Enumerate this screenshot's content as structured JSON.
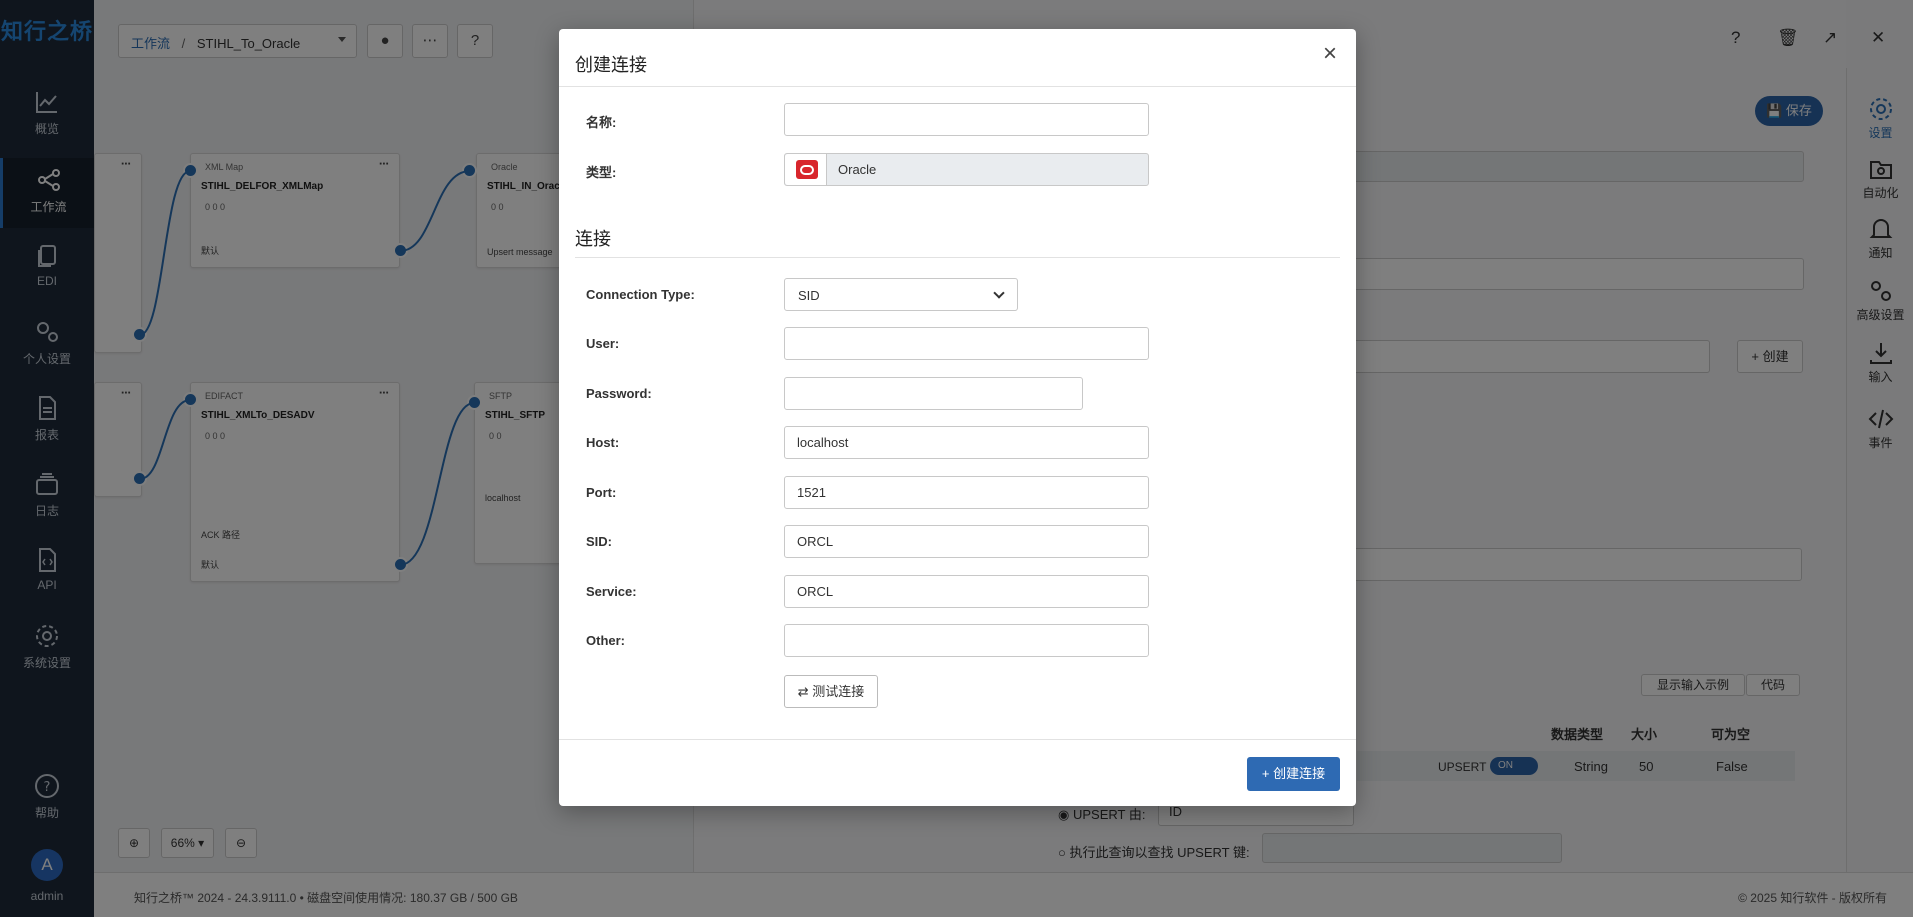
{
  "app": {
    "logo": "知行之桥",
    "nav": [
      {
        "label": "概览",
        "icon": "chart-line-icon"
      },
      {
        "label": "工作流",
        "icon": "workflow-icon"
      },
      {
        "label": "EDI",
        "icon": "documents-icon"
      },
      {
        "label": "个人设置",
        "icon": "user-settings-icon"
      },
      {
        "label": "报表",
        "icon": "report-icon"
      },
      {
        "label": "日志",
        "icon": "log-icon"
      },
      {
        "label": "API",
        "icon": "api-icon"
      },
      {
        "label": "系统设置",
        "icon": "gear-icon"
      },
      {
        "label": "帮助",
        "icon": "help-icon"
      }
    ],
    "user": {
      "initial": "A",
      "name": "admin"
    }
  },
  "workflow": {
    "breadcrumb_link": "工作流",
    "breadcrumb_sep": "/",
    "flow_name": "STIHL_To_Oracle",
    "zoom": "66%",
    "nodes": [
      {
        "tag": "XML Map",
        "name": "STIHL_DELFOR_XMLMap",
        "stats": "0   0   0",
        "foot": "默认"
      },
      {
        "tag": "Oracle",
        "name": "STIHL_IN_Oracle",
        "stats": "0   0",
        "foot": "Upsert message"
      },
      {
        "tag": "EDIFACT",
        "name": "STIHL_XMLTo_DESADV",
        "stats": "0   0   0",
        "foot": "默认",
        "mid": "ACK 路径"
      },
      {
        "tag": "SFTP",
        "name": "STIHL_SFTP",
        "stats": "0   0",
        "foot": "localhost"
      }
    ]
  },
  "right_panel": {
    "save_label": "保存",
    "create_label": "创建",
    "show_input_label": "显示输入示例",
    "code_label": "代码",
    "table_headers": [
      "数据类型",
      "大小",
      "可为空"
    ],
    "row": {
      "upsert": "UPSERT",
      "toggle": "ON",
      "type": "String",
      "size": "50",
      "nullable": "False"
    },
    "upsert_by_label": "UPSERT 由:",
    "upsert_by_value": "ID",
    "exec_query_label": "执行此查询以查找 UPSERT 键:"
  },
  "rightbar": [
    {
      "label": "设置",
      "icon": "gear-icon"
    },
    {
      "label": "自动化",
      "icon": "automation-icon"
    },
    {
      "label": "通知",
      "icon": "bell-icon"
    },
    {
      "label": "高级设置",
      "icon": "advanced-settings-icon"
    },
    {
      "label": "输入",
      "icon": "download-icon"
    },
    {
      "label": "事件",
      "icon": "code-icon"
    }
  ],
  "footer": {
    "left": "知行之桥™ 2024 - 24.3.9111.0  •  磁盘空间使用情况:  180.37 GB / 500 GB",
    "right": "© 2025 知行软件 - 版权所有"
  },
  "modal": {
    "title": "创建连接",
    "name_label": "名称:",
    "name_value": "",
    "type_label": "类型:",
    "type_value": "Oracle",
    "section_title": "连接",
    "fields": {
      "connection_type": {
        "label": "Connection Type:",
        "value": "SID"
      },
      "user": {
        "label": "User:",
        "value": ""
      },
      "password": {
        "label": "Password:",
        "value": ""
      },
      "host": {
        "label": "Host:",
        "value": "localhost"
      },
      "port": {
        "label": "Port:",
        "value": "1521"
      },
      "sid": {
        "label": "SID:",
        "value": "ORCL"
      },
      "service": {
        "label": "Service:",
        "value": "ORCL"
      },
      "other": {
        "label": "Other:",
        "value": ""
      }
    },
    "test_button": "测试连接",
    "create_button": "创建连接"
  },
  "colors": {
    "nav_bg": "#1f2b3a",
    "accent": "#2e6ab3",
    "oracle_red": "#d8262c"
  }
}
